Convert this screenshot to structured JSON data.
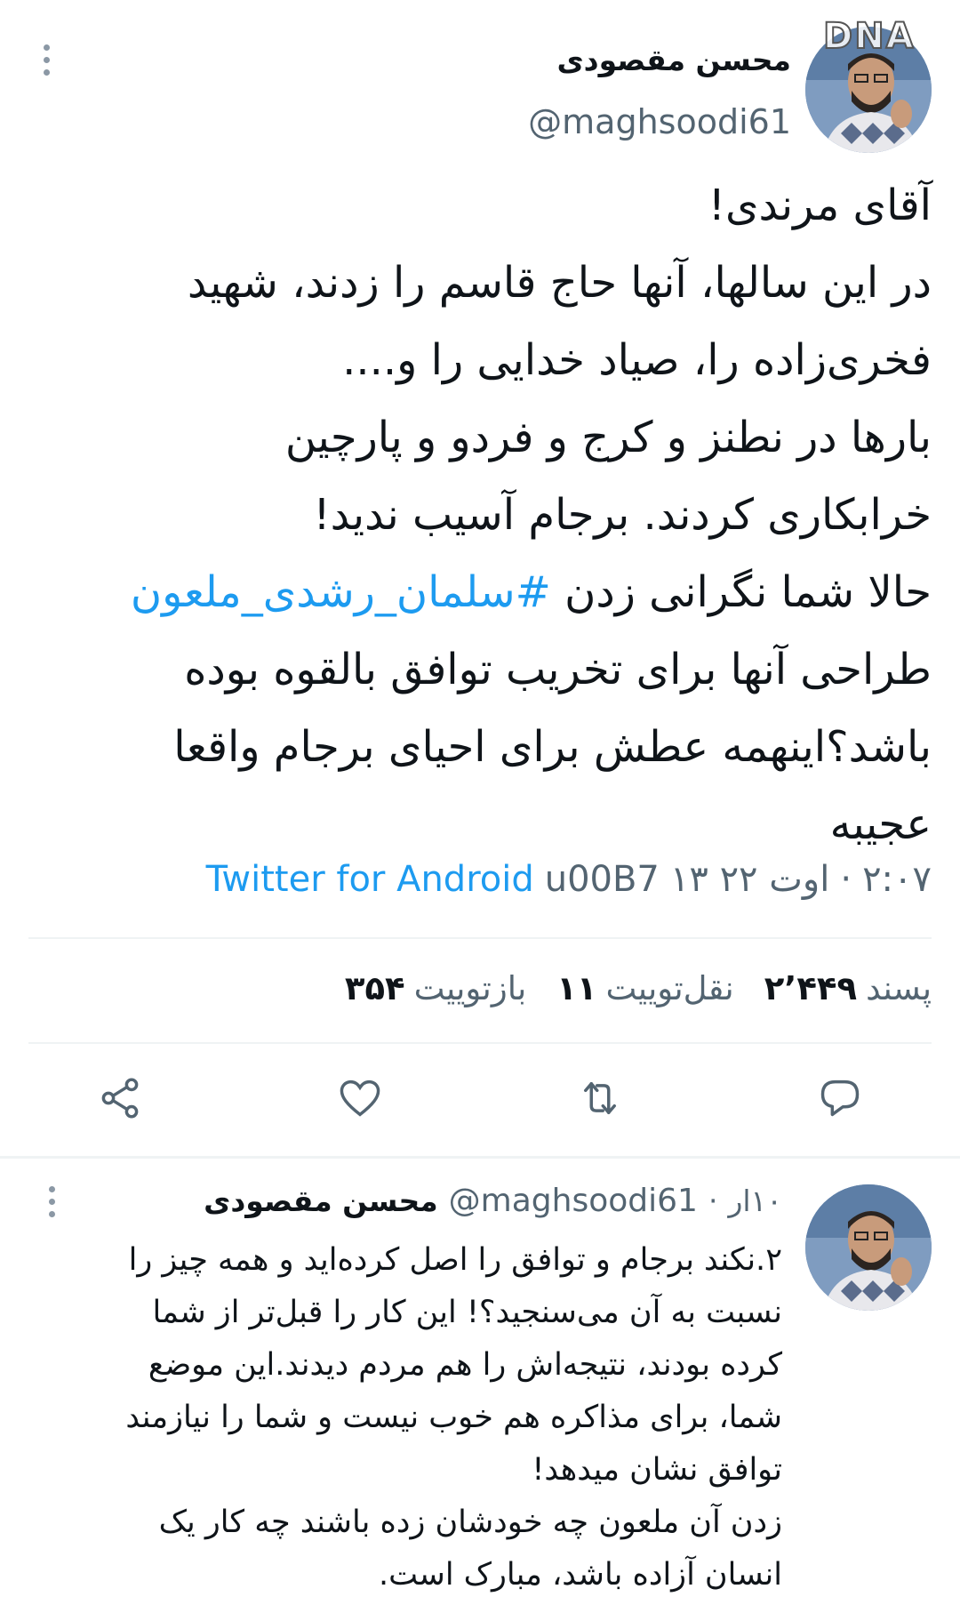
{
  "tweet": {
    "display_name": "محسن مقصودی",
    "handle": "@maghsoodi61",
    "body_lines": [
      "آقای مرندی!",
      "در این سالها، آنها حاج قاسم را زدند، شهید",
      "فخری‌زاده را، صیاد خدایی را و....",
      "بارها در نطنز و کرج و فردو و پارچین",
      "خرابکاری کردند. برجام آسیب ندید!"
    ],
    "body_hashtag_prefix": "حالا شما نگرانی زدن ",
    "hashtag": "#سلمان_رشدی_ملعون",
    "body_after_hashtag": "طراحی آنها برای تخریب توافق بالقوه بوده\nباشد؟اینهمه عطش برای احیای برجام واقعا\nعجیبه",
    "time": "۲:۰۷",
    "separator": "·",
    "date": "۱۳ اوت ۲۲",
    "source_glitch": "u00B7",
    "source": "Twitter for Android",
    "stats": {
      "retweets_num": "۳۵۴",
      "retweets_label": "بازتوییت",
      "quotes_num": "۱۱",
      "quotes_label": "نقل‌توییت",
      "likes_num": "۲٬۴۴۹",
      "likes_label": "پسند"
    },
    "watermark": "DNA"
  },
  "reply": {
    "display_name": "محسن مقصودی",
    "handle": "@maghsoodi61",
    "separator": "·",
    "time": "۱۰ار",
    "body": "۲.نکند برجام و توافق را اصل کرده‌اید و همه چیز را\nنسبت به آن می‌سنجید؟! این کار را قبل‌تر از شما\nکرده بودند، نتیجه‌اش را هم مردم دیدند.این موضع\nشما، برای مذاکره هم خوب نیست و شما را نیازمند\nتوافق نشان میدهد!\nزدن آن ملعون چه خودشان زده باشند چه کار یک\nانسان آزاده باشد، مبارک است."
  },
  "icons": {
    "more": "more-vertical-icon",
    "share": "share-icon",
    "like": "heart-icon",
    "retweet": "retweet-icon",
    "reply": "reply-icon"
  },
  "colors": {
    "accent": "#1d9bf0",
    "secondary_text": "#536471",
    "divider": "#eff3f4"
  }
}
